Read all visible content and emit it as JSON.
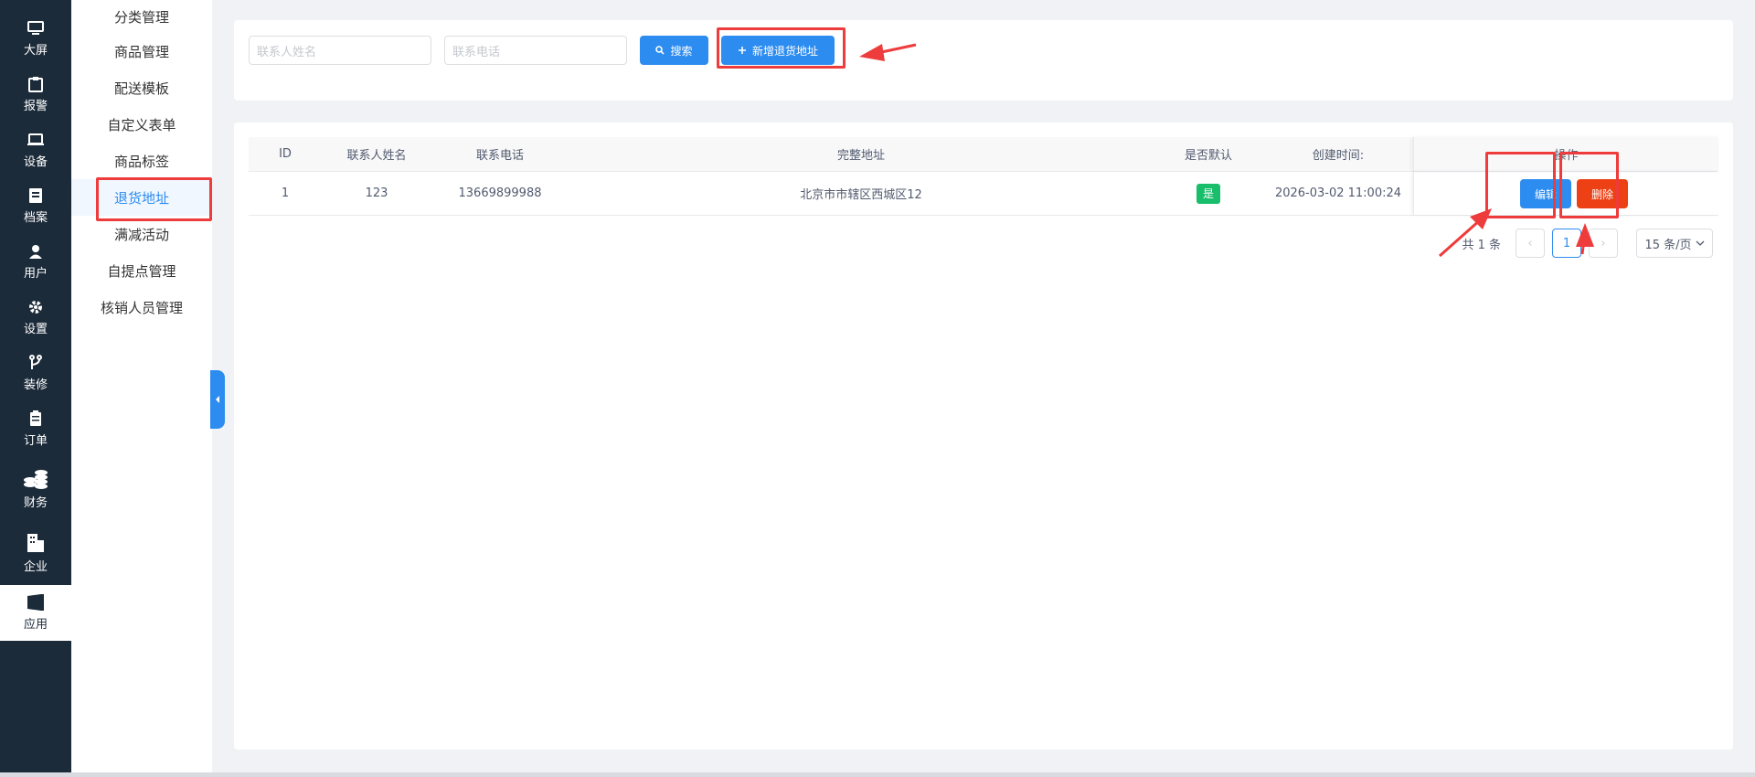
{
  "iconbar": {
    "items": [
      {
        "label": "大屏",
        "icon": "monitor-icon"
      },
      {
        "label": "报警",
        "icon": "clipboard-icon"
      },
      {
        "label": "设备",
        "icon": "device-icon"
      },
      {
        "label": "档案",
        "icon": "file-icon"
      },
      {
        "label": "用户",
        "icon": "user-icon"
      },
      {
        "label": "设置",
        "icon": "gear-icon"
      },
      {
        "label": "装修",
        "icon": "branch-icon"
      },
      {
        "label": "订单",
        "icon": "order-icon"
      },
      {
        "label": "财务",
        "icon": "coins-icon"
      },
      {
        "label": "企业",
        "icon": "building-icon"
      },
      {
        "label": "应用",
        "icon": "windows-icon"
      }
    ],
    "active_index": 10
  },
  "submenu": {
    "items": [
      "分类管理",
      "商品管理",
      "配送模板",
      "自定义表单",
      "商品标签",
      "退货地址",
      "满减活动",
      "自提点管理",
      "核销人员管理"
    ],
    "active_index": 5
  },
  "search": {
    "name_placeholder": "联系人姓名",
    "phone_placeholder": "联系电话",
    "search_label": "搜索",
    "add_label": "新增退货地址"
  },
  "table": {
    "headers": [
      "ID",
      "联系人姓名",
      "联系电话",
      "完整地址",
      "是否默认",
      "创建时间:",
      "操作"
    ],
    "rows": [
      {
        "id": "1",
        "name": "123",
        "phone": "13669899988",
        "address": "北京市市辖区西城区12",
        "default": "是",
        "created": "2026-03-02 11:00:24",
        "edit": "编辑",
        "delete": "删除"
      }
    ]
  },
  "pagination": {
    "total": "共 1 条",
    "prev": "‹",
    "current": "1",
    "next": "›",
    "page_size": "15 条/页"
  },
  "colors": {
    "primary": "#2d8cf0",
    "danger": "#ed4014",
    "success": "#19be6b",
    "sidebar": "#1c2b3a",
    "annotation": "#ee3b3b"
  }
}
